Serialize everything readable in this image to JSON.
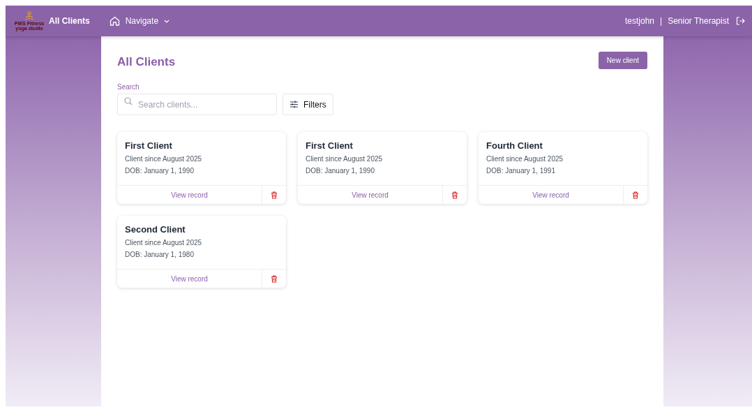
{
  "header": {
    "logo_lines": [
      "PIES Fitness",
      "yoga studio"
    ],
    "title": "All Clients",
    "nav": {
      "label": "Navigate"
    },
    "user": "testjohn",
    "separator": "|",
    "role": "Senior Therapist"
  },
  "page": {
    "title": "All Clients",
    "new_button": "New client",
    "search": {
      "label": "Search",
      "placeholder": "Search clients..."
    },
    "filters_button": "Filters"
  },
  "clients": [
    {
      "name": "First Client",
      "since": "Client since August 2025",
      "dob": "DOB: January 1, 1990",
      "action": "View record"
    },
    {
      "name": "First Client",
      "since": "Client since August 2025",
      "dob": "DOB: January 1, 1990",
      "action": "View record"
    },
    {
      "name": "Fourth Client",
      "since": "Client since August 2025",
      "dob": "DOB: January 1, 1991",
      "action": "View record"
    },
    {
      "name": "Second Client",
      "since": "Client since August 2025",
      "dob": "DOB: January 1, 1980",
      "action": "View record"
    }
  ]
}
